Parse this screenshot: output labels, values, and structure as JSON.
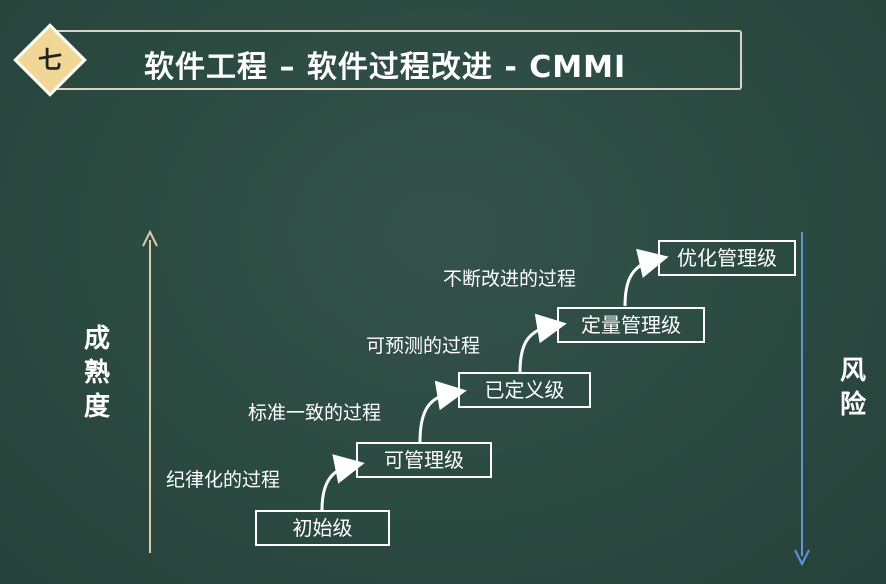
{
  "header": {
    "badge": "七",
    "title": "软件工程 – 软件过程改进 - CMMI"
  },
  "axes": {
    "maturity_label": [
      "成",
      "熟",
      "度"
    ],
    "risk_label": [
      "风",
      "险"
    ],
    "maturity_color": "#e0c9a8",
    "risk_color": "#5f95d6"
  },
  "levels": [
    {
      "label": "初始级"
    },
    {
      "label": "可管理级"
    },
    {
      "label": "已定义级"
    },
    {
      "label": "定量管理级"
    },
    {
      "label": "优化管理级"
    }
  ],
  "transitions": [
    {
      "label": "纪律化的过程"
    },
    {
      "label": "标准一致的过程"
    },
    {
      "label": "可预测的过程"
    },
    {
      "label": "不断改进的过程"
    }
  ]
}
